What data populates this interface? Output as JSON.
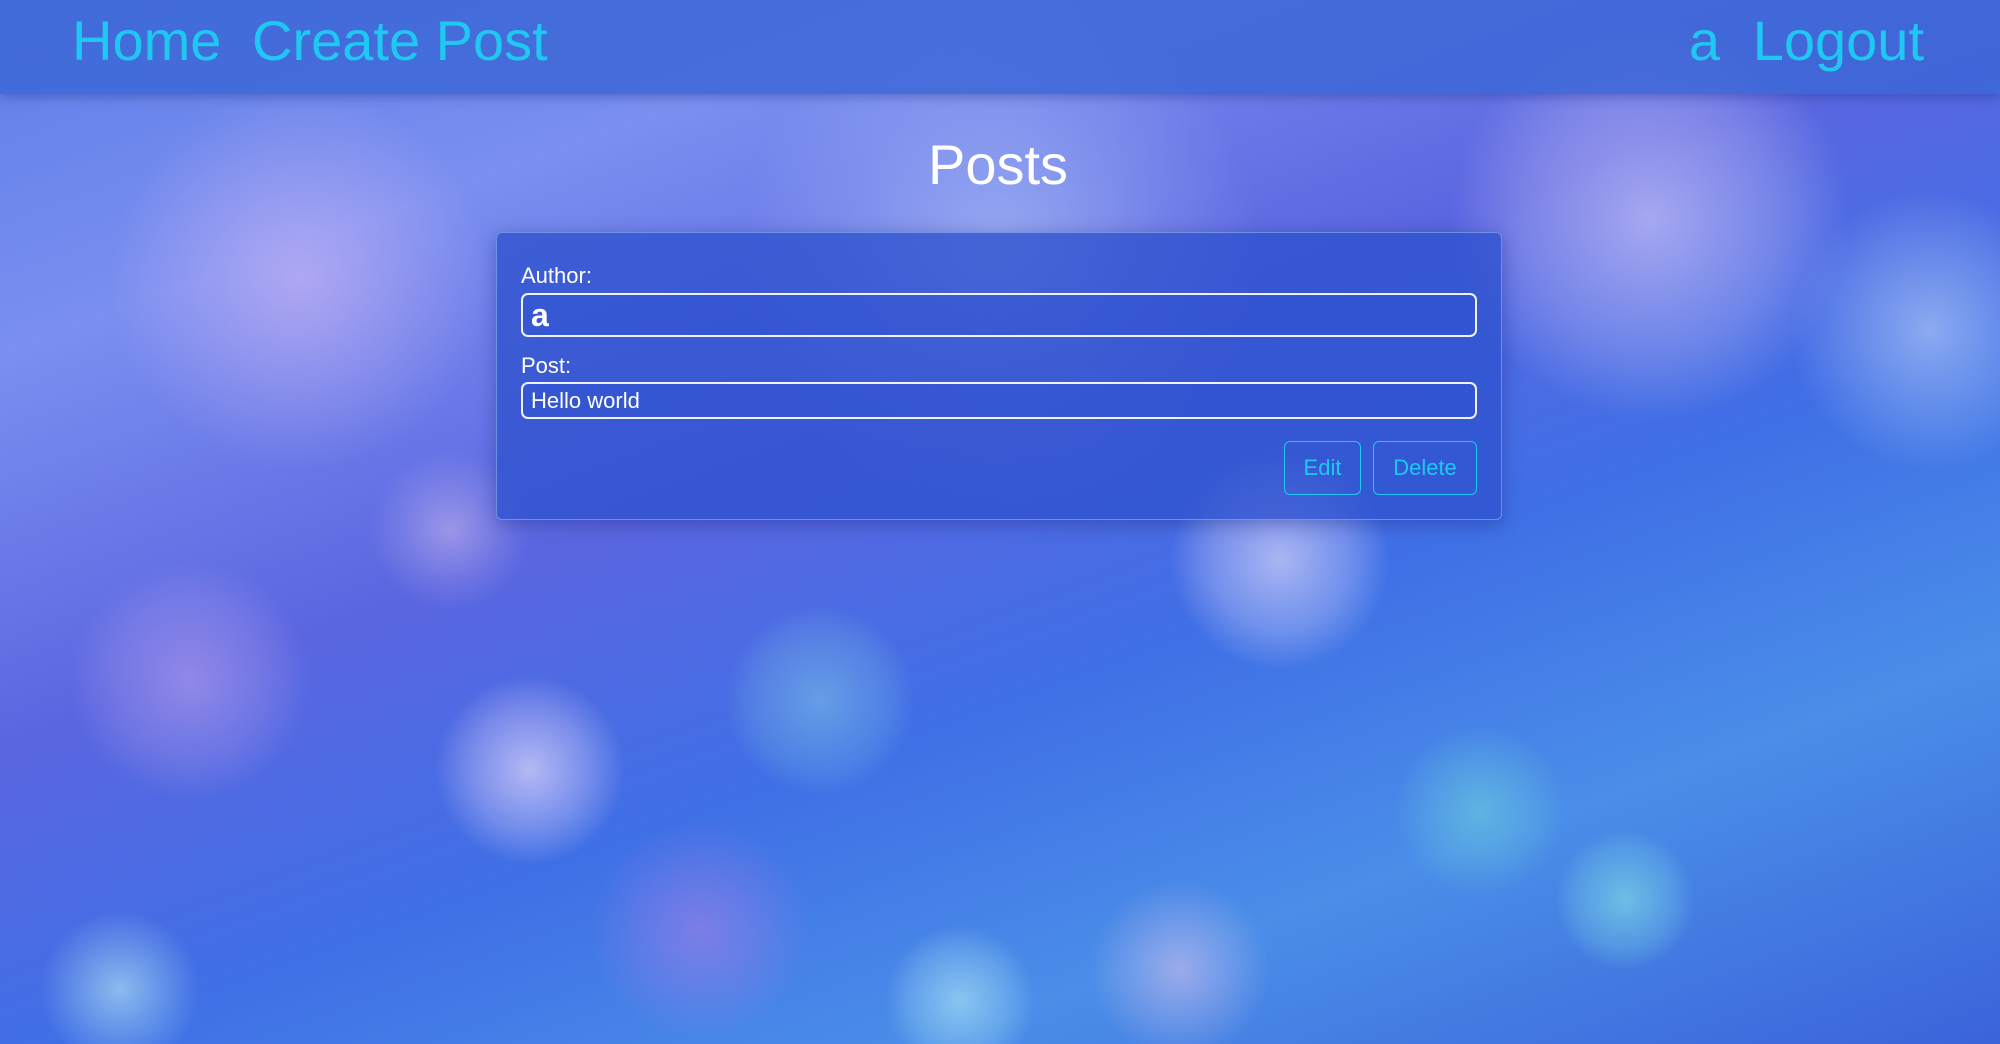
{
  "nav": {
    "home_label": "Home",
    "create_post_label": "Create Post",
    "user_label": "a",
    "logout_label": "Logout"
  },
  "page": {
    "title": "Posts"
  },
  "post": {
    "author_label": "Author:",
    "author_value": "a",
    "post_label": "Post:",
    "post_value": "Hello world",
    "edit_label": "Edit",
    "delete_label": "Delete"
  },
  "colors": {
    "accent": "#1ec8f2",
    "navbar": "#3a66d6",
    "card": "#2e52ce",
    "text": "#ffffff"
  }
}
